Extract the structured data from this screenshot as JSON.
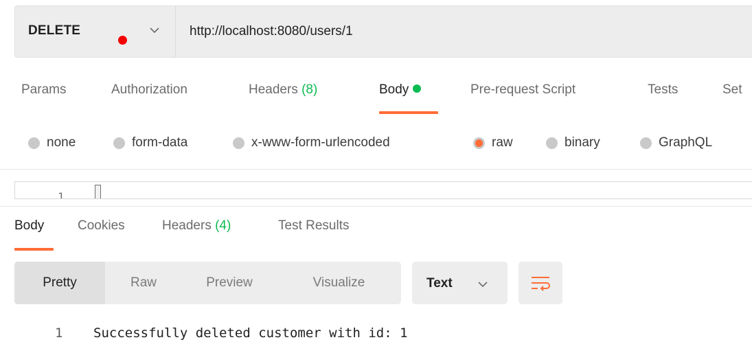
{
  "request": {
    "method": "DELETE",
    "url": "http://localhost:8080/users/1"
  },
  "request_tabs": [
    {
      "label": "Params"
    },
    {
      "label": "Authorization"
    },
    {
      "label": "Headers",
      "count": "(8)"
    },
    {
      "label": "Body",
      "active": true,
      "indicator": "green-dot"
    },
    {
      "label": "Pre-request Script"
    },
    {
      "label": "Tests"
    },
    {
      "label": "Set"
    }
  ],
  "body_types": [
    {
      "label": "none"
    },
    {
      "label": "form-data"
    },
    {
      "label": "x-www-form-urlencoded"
    },
    {
      "label": "raw",
      "selected": true
    },
    {
      "label": "binary"
    },
    {
      "label": "GraphQL"
    }
  ],
  "editor": {
    "line_number": "1"
  },
  "response_tabs": [
    {
      "label": "Body",
      "active": true
    },
    {
      "label": "Cookies"
    },
    {
      "label": "Headers",
      "count": "(4)"
    },
    {
      "label": "Test Results"
    }
  ],
  "response_view": {
    "modes": [
      "Pretty",
      "Raw",
      "Preview",
      "Visualize"
    ],
    "active_mode": "Pretty",
    "format": "Text",
    "wrap_icon": "wrap-lines-icon"
  },
  "response_body": {
    "lines": [
      {
        "number": "1",
        "text": "Successfully deleted customer with id: 1"
      }
    ]
  },
  "colors": {
    "accent": "#ff6c37",
    "method_indicator": "#f50000",
    "count_green": "#0cbb52"
  }
}
